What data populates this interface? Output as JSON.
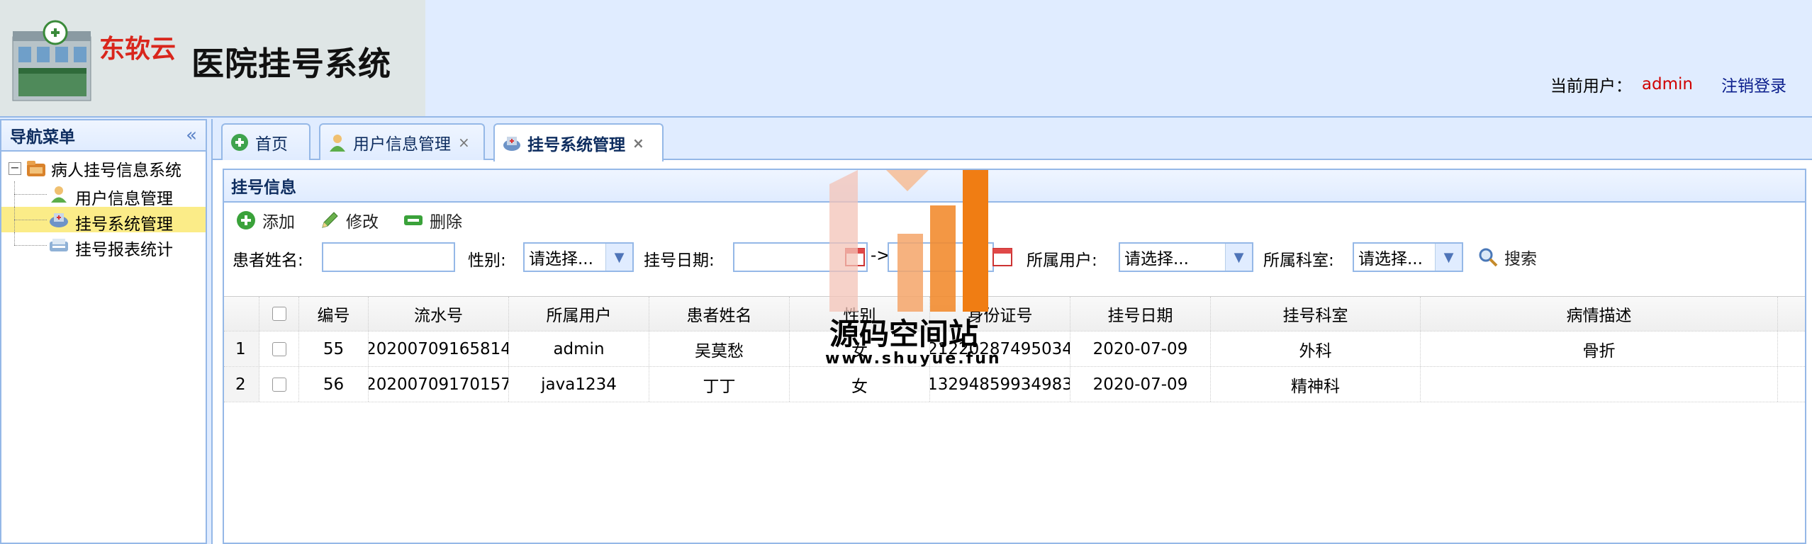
{
  "header": {
    "brand": "东软云",
    "title": "医院挂号系统",
    "current_user_label": "当前用户：",
    "current_user": "admin",
    "logout": "注销登录"
  },
  "nav": {
    "title": "导航菜单",
    "collapse_glyph": "«",
    "root": "病人挂号信息系统",
    "items": [
      {
        "label": "用户信息管理",
        "icon": "user-icon"
      },
      {
        "label": "挂号系统管理",
        "icon": "hospital-icon",
        "selected": true
      },
      {
        "label": "挂号报表统计",
        "icon": "report-icon"
      }
    ]
  },
  "tabs": [
    {
      "label": "首页",
      "icon": "home-icon",
      "closable": false
    },
    {
      "label": "用户信息管理",
      "icon": "user-icon",
      "closable": true
    },
    {
      "label": "挂号系统管理",
      "icon": "hospital-icon",
      "closable": true,
      "active": true
    }
  ],
  "panel": {
    "title": "挂号信息",
    "toolbar": {
      "add": "添加",
      "edit": "修改",
      "delete": "删除"
    },
    "search": {
      "patient_name_label": "患者姓名:",
      "patient_name_value": "",
      "gender_label": "性别:",
      "gender_value": "请选择...",
      "date_label": "挂号日期:",
      "date_from": "",
      "date_sep": "->",
      "date_to": "",
      "owner_label": "所属用户:",
      "owner_value": "请选择...",
      "dept_label": "所属科室:",
      "dept_value": "请选择...",
      "search_button": "搜索"
    }
  },
  "table": {
    "columns": [
      "编号",
      "流水号",
      "所属用户",
      "患者姓名",
      "性别",
      "身份证号",
      "挂号日期",
      "挂号科室",
      "病情描述"
    ],
    "rows": [
      {
        "n": "1",
        "id": "55",
        "serial": "20200709165814",
        "owner": "admin",
        "name": "吴莫愁",
        "gender": "女",
        "idcard": "21220287495034",
        "date": "2020-07-09",
        "dept": "外科",
        "desc": "骨折"
      },
      {
        "n": "2",
        "id": "56",
        "serial": "20200709170157",
        "owner": "java1234",
        "name": "丁丁",
        "gender": "女",
        "idcard": "13294859934983",
        "date": "2020-07-09",
        "dept": "精神科",
        "desc": ""
      }
    ]
  },
  "watermark": {
    "text": "源码空间站",
    "url": "www.shuyue.fun"
  },
  "colors": {
    "border": "#95b8e7",
    "header_bg": "#e0ecff",
    "selected": "#fbec88",
    "user_red": "#d00000",
    "logout_blue": "#0a1d8c"
  }
}
